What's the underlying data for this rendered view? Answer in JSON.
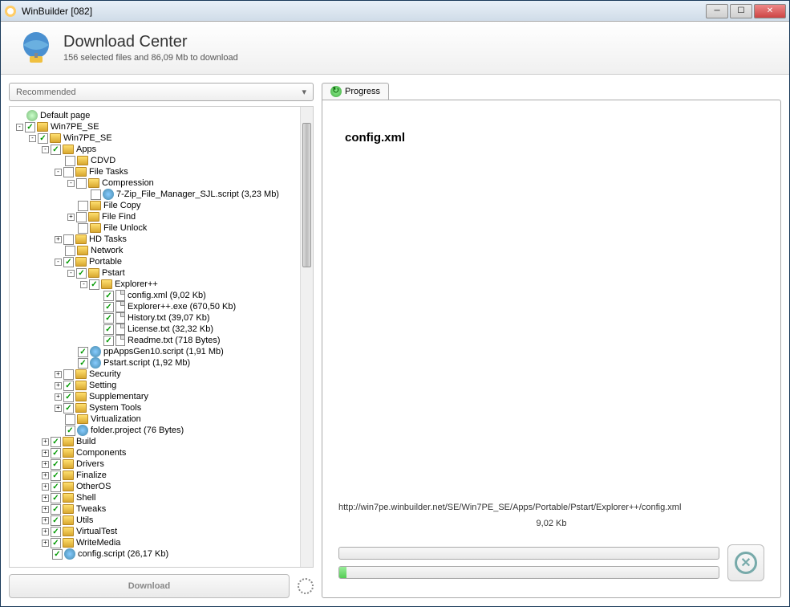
{
  "window": {
    "title": "WinBuilder [082]"
  },
  "header": {
    "title": "Download Center",
    "subtitle": "156 selected files and 86,09 Mb to download"
  },
  "dropdown": {
    "selected": "Recommended"
  },
  "download_button": "Download",
  "progress": {
    "tab_label": "Progress",
    "current_file": "config.xml",
    "url": "http://win7pe.winbuilder.net/SE/Win7PE_SE/Apps/Portable/Pstart/Explorer++/config.xml",
    "size": "9,02 Kb",
    "bar1_percent": 0,
    "bar2_percent": 2
  },
  "tree": [
    {
      "indent": 0,
      "exp": "",
      "chk": "none",
      "icon": "page",
      "label": "Default page"
    },
    {
      "indent": 0,
      "exp": "-",
      "chk": "on",
      "icon": "folder",
      "label": "Win7PE_SE"
    },
    {
      "indent": 1,
      "exp": "-",
      "chk": "on",
      "icon": "folder",
      "label": "Win7PE_SE"
    },
    {
      "indent": 2,
      "exp": "-",
      "chk": "on",
      "icon": "folder",
      "label": "Apps"
    },
    {
      "indent": 3,
      "exp": "",
      "chk": "off",
      "icon": "folder",
      "label": "CDVD"
    },
    {
      "indent": 3,
      "exp": "-",
      "chk": "off",
      "icon": "folder",
      "label": "File Tasks"
    },
    {
      "indent": 4,
      "exp": "-",
      "chk": "off",
      "icon": "folder",
      "label": "Compression"
    },
    {
      "indent": 5,
      "exp": "",
      "chk": "off",
      "icon": "script",
      "label": "7-Zip_File_Manager_SJL.script (3,23 Mb)"
    },
    {
      "indent": 4,
      "exp": "",
      "chk": "off",
      "icon": "folder",
      "label": "File Copy"
    },
    {
      "indent": 4,
      "exp": "+",
      "chk": "off",
      "icon": "folder",
      "label": "File Find"
    },
    {
      "indent": 4,
      "exp": "",
      "chk": "off",
      "icon": "folder",
      "label": "File Unlock"
    },
    {
      "indent": 3,
      "exp": "+",
      "chk": "off",
      "icon": "folder",
      "label": "HD Tasks"
    },
    {
      "indent": 3,
      "exp": "",
      "chk": "off",
      "icon": "folder",
      "label": "Network"
    },
    {
      "indent": 3,
      "exp": "-",
      "chk": "on",
      "icon": "folder",
      "label": "Portable"
    },
    {
      "indent": 4,
      "exp": "-",
      "chk": "on",
      "icon": "folder",
      "label": "Pstart"
    },
    {
      "indent": 5,
      "exp": "-",
      "chk": "on",
      "icon": "folder",
      "label": "Explorer++"
    },
    {
      "indent": 6,
      "exp": "",
      "chk": "on",
      "icon": "file",
      "label": "config.xml (9,02 Kb)"
    },
    {
      "indent": 6,
      "exp": "",
      "chk": "on",
      "icon": "file",
      "label": "Explorer++.exe (670,50 Kb)"
    },
    {
      "indent": 6,
      "exp": "",
      "chk": "on",
      "icon": "file",
      "label": "History.txt (39,07 Kb)"
    },
    {
      "indent": 6,
      "exp": "",
      "chk": "on",
      "icon": "file",
      "label": "License.txt (32,32 Kb)"
    },
    {
      "indent": 6,
      "exp": "",
      "chk": "on",
      "icon": "file",
      "label": "Readme.txt (718 Bytes)"
    },
    {
      "indent": 4,
      "exp": "",
      "chk": "on",
      "icon": "script",
      "label": "ppAppsGen10.script (1,91 Mb)"
    },
    {
      "indent": 4,
      "exp": "",
      "chk": "on",
      "icon": "script",
      "label": "Pstart.script (1,92 Mb)"
    },
    {
      "indent": 3,
      "exp": "+",
      "chk": "off",
      "icon": "folder",
      "label": "Security"
    },
    {
      "indent": 3,
      "exp": "+",
      "chk": "on",
      "icon": "folder",
      "label": "Setting"
    },
    {
      "indent": 3,
      "exp": "+",
      "chk": "on",
      "icon": "folder",
      "label": "Supplementary"
    },
    {
      "indent": 3,
      "exp": "+",
      "chk": "on",
      "icon": "folder",
      "label": "System Tools"
    },
    {
      "indent": 3,
      "exp": "",
      "chk": "off",
      "icon": "folder",
      "label": "Virtualization"
    },
    {
      "indent": 3,
      "exp": "",
      "chk": "on",
      "icon": "script",
      "label": "folder.project (76 Bytes)"
    },
    {
      "indent": 2,
      "exp": "+",
      "chk": "on",
      "icon": "folder",
      "label": "Build"
    },
    {
      "indent": 2,
      "exp": "+",
      "chk": "on",
      "icon": "folder",
      "label": "Components"
    },
    {
      "indent": 2,
      "exp": "+",
      "chk": "on",
      "icon": "folder",
      "label": "Drivers"
    },
    {
      "indent": 2,
      "exp": "+",
      "chk": "on",
      "icon": "folder",
      "label": "Finalize"
    },
    {
      "indent": 2,
      "exp": "+",
      "chk": "on",
      "icon": "folder",
      "label": "OtherOS"
    },
    {
      "indent": 2,
      "exp": "+",
      "chk": "on",
      "icon": "folder",
      "label": "Shell"
    },
    {
      "indent": 2,
      "exp": "+",
      "chk": "on",
      "icon": "folder",
      "label": "Tweaks"
    },
    {
      "indent": 2,
      "exp": "+",
      "chk": "on",
      "icon": "folder",
      "label": "Utils"
    },
    {
      "indent": 2,
      "exp": "+",
      "chk": "on",
      "icon": "folder",
      "label": "VirtualTest"
    },
    {
      "indent": 2,
      "exp": "+",
      "chk": "on",
      "icon": "folder",
      "label": "WriteMedia"
    },
    {
      "indent": 2,
      "exp": "",
      "chk": "on",
      "icon": "script",
      "label": "config.script (26,17 Kb)"
    }
  ]
}
